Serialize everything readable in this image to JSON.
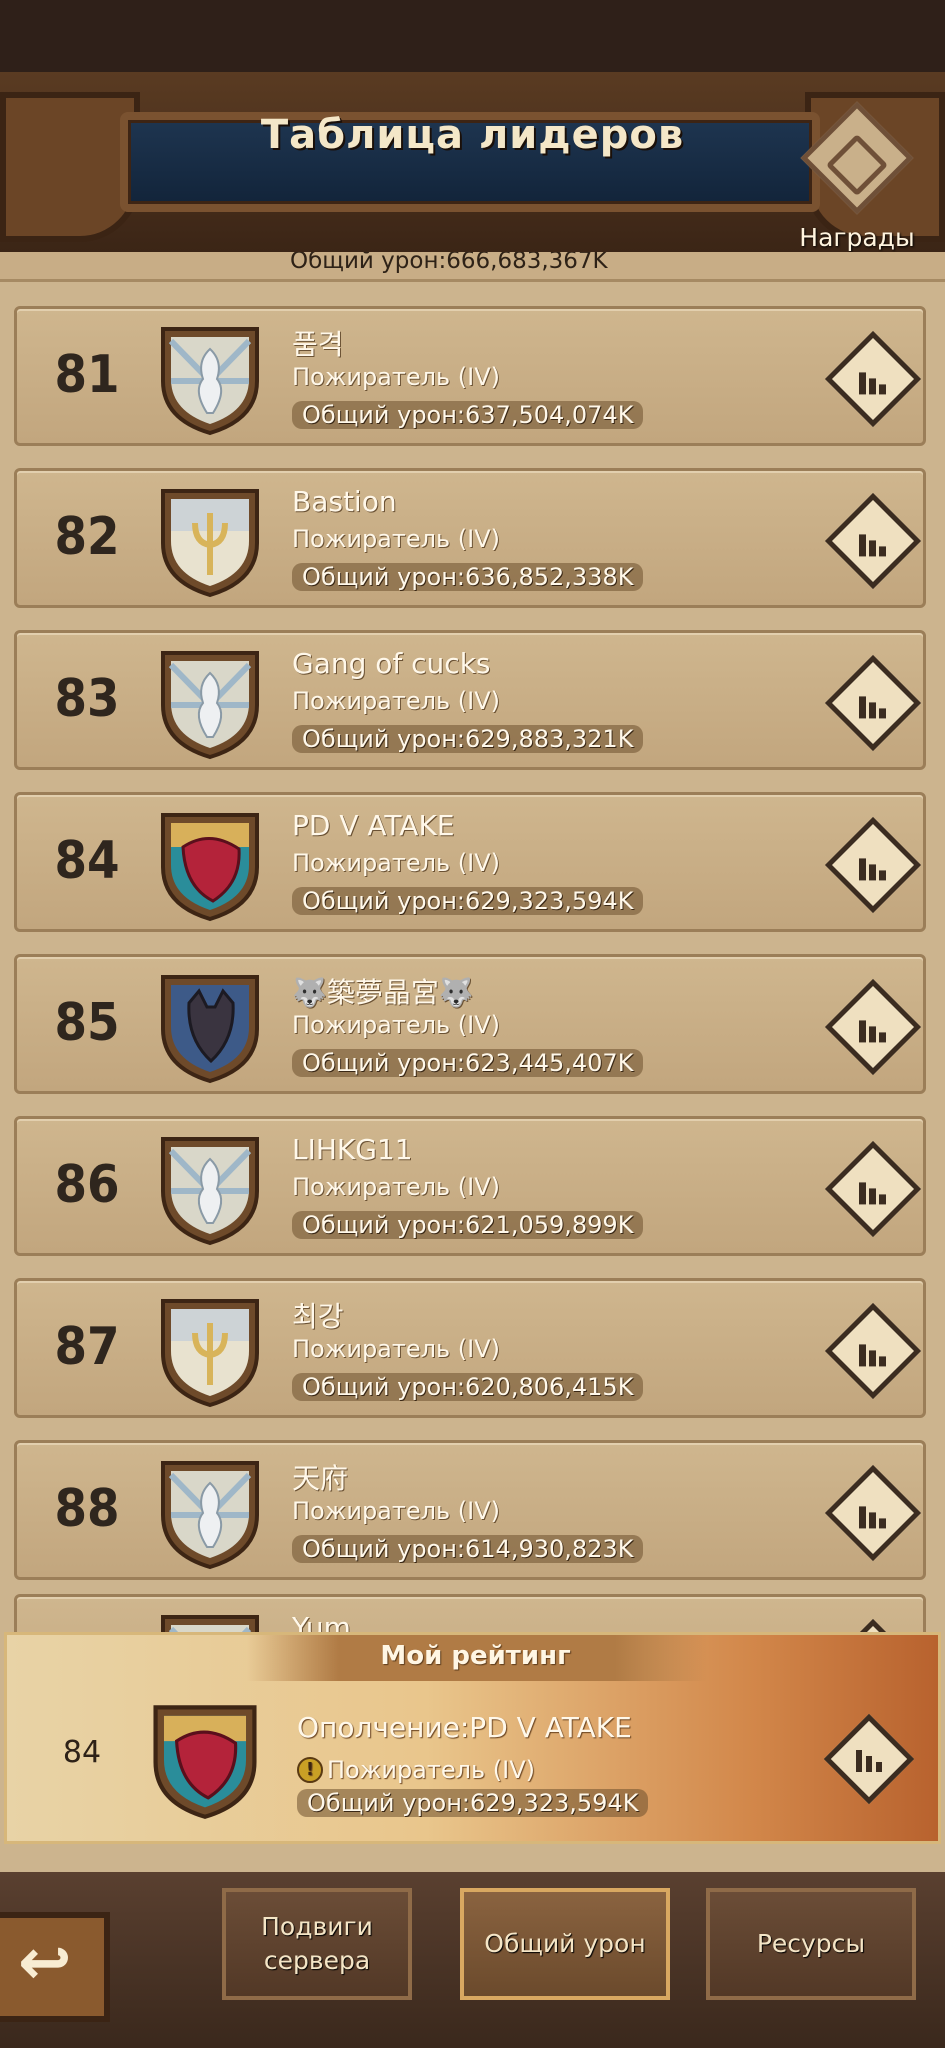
{
  "header": {
    "title": "Таблица лидеров",
    "rewards_label": "Награды"
  },
  "partial_top_row": {
    "damage": "Общий урон:666,683,367K"
  },
  "rows": [
    {
      "rank": "81",
      "name": "품격",
      "tier": "Пожиратель (IV)",
      "damage": "Общий урон:637,504,074K",
      "emblem": "silver-dragon"
    },
    {
      "rank": "82",
      "name": "Bastion",
      "tier": "Пожиратель (IV)",
      "damage": "Общий урон:636,852,338K",
      "emblem": "trident"
    },
    {
      "rank": "83",
      "name": "Gang of cucks",
      "tier": "Пожиратель (IV)",
      "damage": "Общий урон:629,883,321K",
      "emblem": "silver-dragon"
    },
    {
      "rank": "84",
      "name": "PD V ATAKE",
      "tier": "Пожиратель (IV)",
      "damage": "Общий урон:629,323,594K",
      "emblem": "red-beast"
    },
    {
      "rank": "85",
      "name": "🐺築夢晶宮🐺",
      "tier": "Пожиратель (IV)",
      "damage": "Общий урон:623,445,407K",
      "emblem": "blue-wolf"
    },
    {
      "rank": "86",
      "name": "LIHKG11",
      "tier": "Пожиратель (IV)",
      "damage": "Общий урон:621,059,899K",
      "emblem": "silver-dragon"
    },
    {
      "rank": "87",
      "name": "최강",
      "tier": "Пожиратель (IV)",
      "damage": "Общий урон:620,806,415K",
      "emblem": "trident"
    },
    {
      "rank": "88",
      "name": "天府",
      "tier": "Пожиратель (IV)",
      "damage": "Общий урон:614,930,823K",
      "emblem": "silver-dragon"
    },
    {
      "rank": "",
      "name": "Yum",
      "tier": "",
      "damage": "",
      "emblem": "silver-dragon"
    }
  ],
  "my_rating": {
    "title": "Мой рейтинг",
    "rank": "84",
    "name": "Ополчение:PD V ATAKE",
    "tier": "Пожиратель (IV)",
    "damage": "Общий урон:629,323,594K",
    "warning_glyph": "!"
  },
  "tabs": [
    {
      "label": "Подвиги сервера",
      "active": false
    },
    {
      "label": "Общий урон",
      "active": true
    },
    {
      "label": "Ресурсы",
      "active": false
    }
  ],
  "back_glyph": "↩",
  "colors": {
    "accent_row": "#c2a67e",
    "header_plank": "#12243a",
    "my_panel_orange": "#d2874a"
  }
}
